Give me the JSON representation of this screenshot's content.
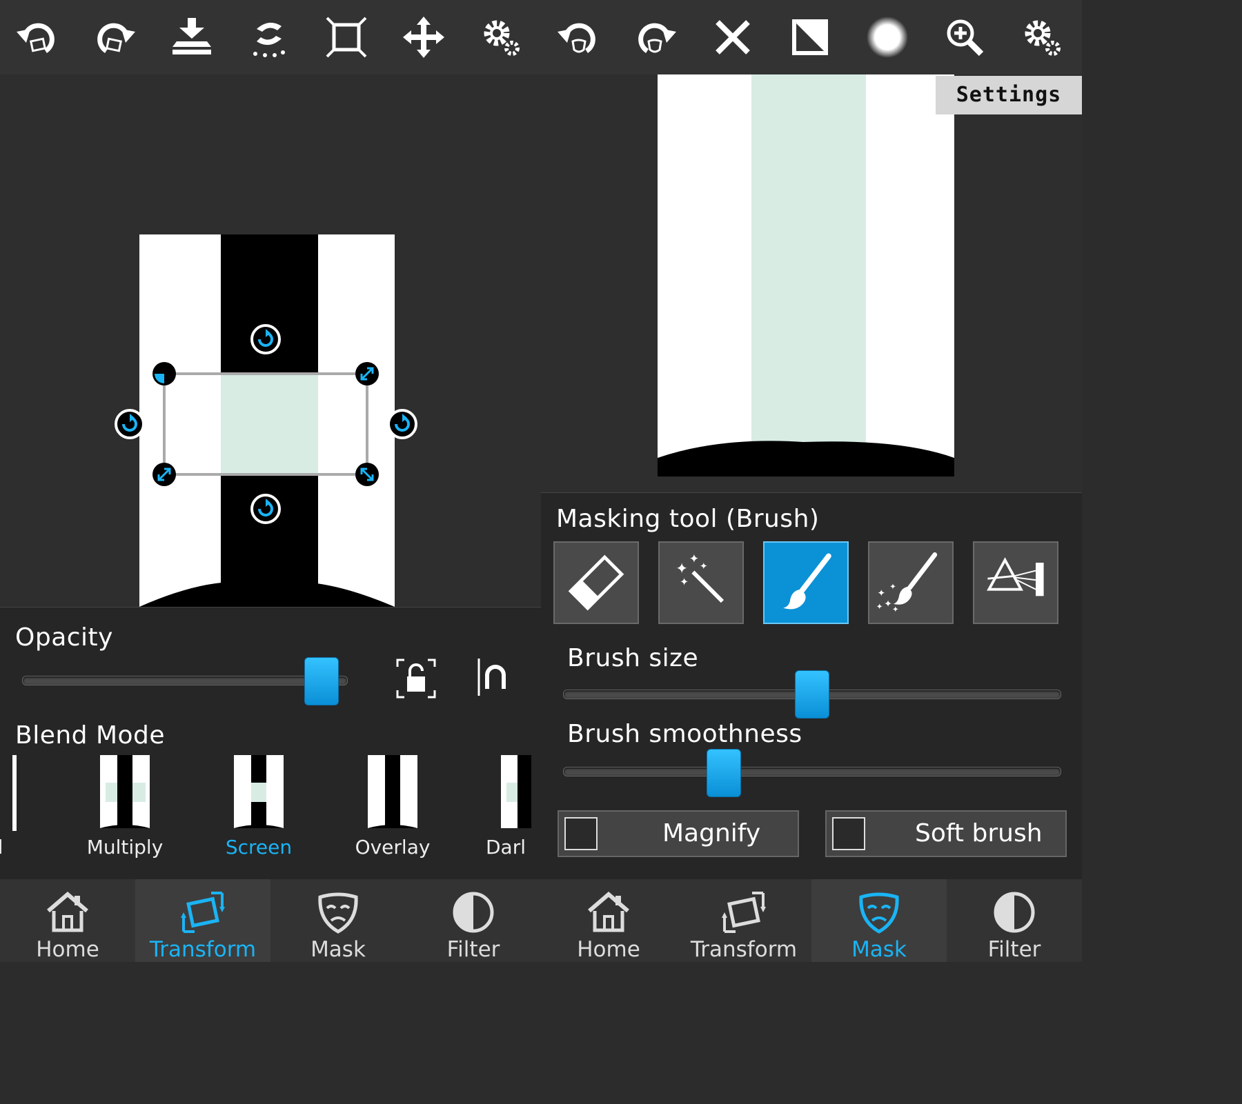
{
  "toolbar": {
    "icons": [
      "undo-transform-icon",
      "redo-transform-icon",
      "merge-down-icon",
      "transform-reset-icon",
      "fit-canvas-icon",
      "move-icon",
      "settings-icon",
      "undo-mask-icon",
      "redo-mask-icon",
      "clear-mask-icon",
      "invert-mask-icon",
      "brush-preview-icon",
      "zoom-icon",
      "settings-icon"
    ]
  },
  "tooltip": {
    "text": "Settings"
  },
  "transform_panel": {
    "opacity_label": "Opacity",
    "opacity_value": 0.93,
    "blend_mode_label": "Blend Mode",
    "blend_modes": [
      {
        "label": "al",
        "active": false
      },
      {
        "label": "Multiply",
        "active": false
      },
      {
        "label": "Screen",
        "active": true
      },
      {
        "label": "Overlay",
        "active": false
      },
      {
        "label": "Darl",
        "active": false
      }
    ]
  },
  "mask_panel": {
    "title": "Masking tool (Brush)",
    "tools": [
      "eraser-icon",
      "magic-wand-icon",
      "brush-icon",
      "spray-brush-icon",
      "gradient-prism-icon"
    ],
    "active_tool": "brush-icon",
    "brush_size_label": "Brush size",
    "brush_size_value": 0.5,
    "brush_smoothness_label": "Brush smoothness",
    "brush_smoothness_value": 0.31,
    "magnify_label": "Magnify",
    "magnify_checked": false,
    "soft_brush_label": "Soft brush",
    "soft_brush_checked": false
  },
  "nav_left": [
    {
      "label": "Home",
      "icon": "home-icon",
      "active": false
    },
    {
      "label": "Transform",
      "icon": "transform-icon",
      "active": true
    },
    {
      "label": "Mask",
      "icon": "mask-icon",
      "active": false
    },
    {
      "label": "Filter",
      "icon": "filter-icon",
      "active": false
    }
  ],
  "nav_right": [
    {
      "label": "Home",
      "icon": "home-icon",
      "active": false
    },
    {
      "label": "Transform",
      "icon": "transform-icon",
      "active": false
    },
    {
      "label": "Mask",
      "icon": "mask-icon",
      "active": true
    },
    {
      "label": "Filter",
      "icon": "filter-icon",
      "active": false
    }
  ],
  "colors": {
    "accent": "#1ab4f5",
    "toolbar": "#333333",
    "panel": "#2e2e2e",
    "mint": "#d8ece4"
  }
}
